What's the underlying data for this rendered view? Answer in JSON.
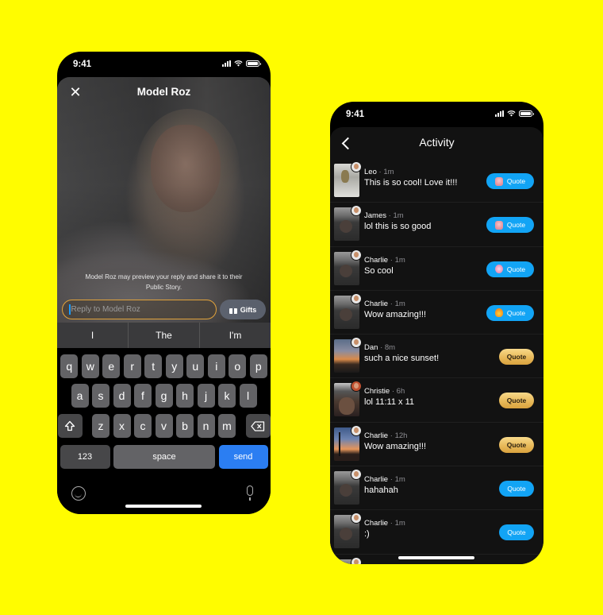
{
  "left_phone": {
    "status": {
      "time": "9:41"
    },
    "header": {
      "close_icon": "close-icon",
      "title": "Model Roz"
    },
    "preview_note": "Model Roz may preview your reply and share it to their Public Story.",
    "reply": {
      "placeholder": "Reply to Model Roz",
      "value": ""
    },
    "gifts_button": "Gifts",
    "suggestions": [
      "I",
      "The",
      "I'm"
    ],
    "keyboard": {
      "row1": [
        "q",
        "w",
        "e",
        "r",
        "t",
        "y",
        "u",
        "i",
        "o",
        "p"
      ],
      "row2": [
        "a",
        "s",
        "d",
        "f",
        "g",
        "h",
        "j",
        "k",
        "l"
      ],
      "row3": [
        "z",
        "x",
        "c",
        "v",
        "b",
        "n",
        "m"
      ],
      "numbers_key": "123",
      "space_key": "space",
      "send_key": "send",
      "shift_icon": "shift-icon",
      "delete_icon": "backspace-icon",
      "emoji_icon": "emoji-icon",
      "mic_icon": "microphone-icon"
    }
  },
  "right_phone": {
    "status": {
      "time": "9:41"
    },
    "header": {
      "back_icon": "chevron-left-icon",
      "title": "Activity"
    },
    "items": [
      {
        "name": "Leo",
        "time": "1m",
        "message": "This is so cool! Love it!!!",
        "quote": "Quote",
        "style": "blue",
        "badge": "pink"
      },
      {
        "name": "James",
        "time": "1m",
        "message": "lol this is so good",
        "quote": "Quote",
        "style": "blue",
        "badge": "pink"
      },
      {
        "name": "Charlie",
        "time": "1m",
        "message": "So cool",
        "quote": "Quote",
        "style": "blue",
        "badge": "heart"
      },
      {
        "name": "Charlie",
        "time": "1m",
        "message": "Wow amazing!!!",
        "quote": "Quote",
        "style": "blue",
        "badge": "fire"
      },
      {
        "name": "Dan",
        "time": "8m",
        "message": "such a nice sunset!",
        "quote": "Quote",
        "style": "gold"
      },
      {
        "name": "Christie",
        "time": "6h",
        "message": "lol 11:11 x 11",
        "quote": "Quote",
        "style": "gold"
      },
      {
        "name": "Charlie",
        "time": "12h",
        "message": "Wow amazing!!!",
        "quote": "Quote",
        "style": "gold"
      },
      {
        "name": "Charlie",
        "time": "1m",
        "message": "hahahah",
        "quote": "Quote",
        "style": "blue-plain"
      },
      {
        "name": "Charlie",
        "time": "1m",
        "message": ":)",
        "quote": "Quote",
        "style": "blue-plain"
      }
    ]
  },
  "colors": {
    "background": "#FFFC00",
    "quote_blue": "#12A4F5",
    "quote_gold": "#E7B756",
    "send_key": "#2B7EF2",
    "reply_border": "#E2A33B"
  }
}
